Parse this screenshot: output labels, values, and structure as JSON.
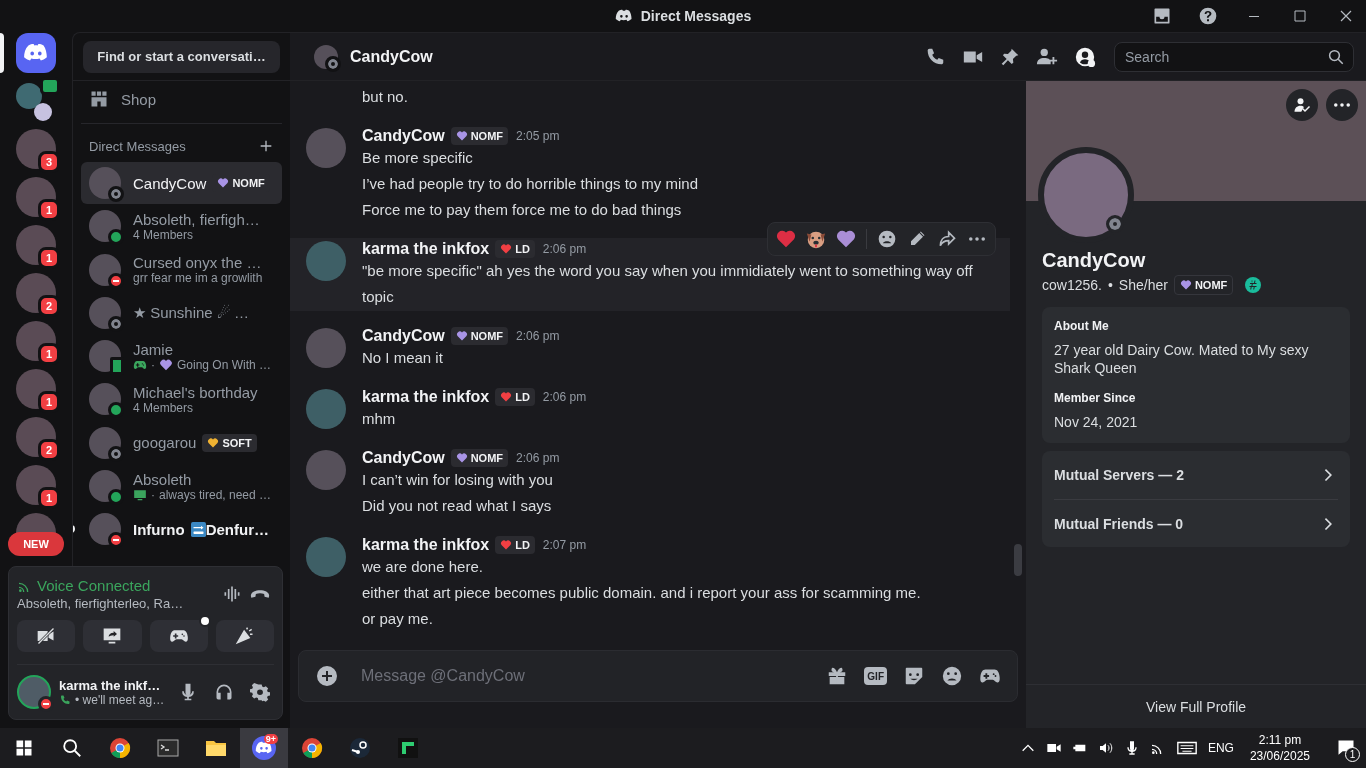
{
  "window": {
    "title": "Direct Messages"
  },
  "servers": [
    {
      "kind": "home",
      "selected": true
    },
    {
      "kind": "group",
      "selected": false
    },
    {
      "kind": "avatar",
      "badge": "3",
      "selected": false
    },
    {
      "kind": "avatar",
      "badge": "1",
      "selected": false
    },
    {
      "kind": "avatar",
      "badge": "1",
      "selected": false
    },
    {
      "kind": "avatar",
      "badge": "2",
      "selected": false
    },
    {
      "kind": "avatar",
      "badge": "1",
      "selected": false
    },
    {
      "kind": "avatar",
      "badge": "1",
      "selected": false
    },
    {
      "kind": "avatar",
      "badge": "2",
      "selected": false
    },
    {
      "kind": "avatar",
      "badge": "1",
      "selected": false
    },
    {
      "kind": "avatar",
      "selected": false
    }
  ],
  "new_pill": "NEW",
  "dm_sidebar": {
    "search": "Find or start a conversati…",
    "shop": "Shop",
    "header": "Direct Messages"
  },
  "dms": [
    {
      "name": "CandyCow",
      "tag": {
        "label": "NOMF",
        "color": "#a994e6"
      },
      "presence": {
        "kind": "offline"
      },
      "selected": true,
      "unread": false
    },
    {
      "name": "Absoleth, fierfigh…",
      "subtitle": [
        {
          "kind": "text",
          "text": "4 Members"
        }
      ],
      "presence": {
        "kind": "online"
      },
      "selected": false,
      "unread": false
    },
    {
      "name": "Cursed onyx the …",
      "subtitle": [
        {
          "kind": "text",
          "text": "grr fear me im a growlith"
        }
      ],
      "presence": {
        "kind": "dnd"
      },
      "selected": false,
      "unread": false
    },
    {
      "name": "★ Sunshine ☄ …",
      "presence": {
        "kind": "offline"
      },
      "selected": false,
      "unread": false
    },
    {
      "name": "Jamie",
      "subtitle": [
        {
          "kind": "game"
        },
        {
          "kind": "text",
          "text": "·"
        },
        {
          "kind": "heart"
        },
        {
          "kind": "text",
          "text": "Going On With …"
        }
      ],
      "presence": {
        "kind": "mobile"
      },
      "selected": false,
      "unread": false
    },
    {
      "name": "Michael's borthday",
      "subtitle": [
        {
          "kind": "text",
          "text": "4 Members"
        }
      ],
      "presence": {
        "kind": "online"
      },
      "selected": false,
      "unread": false
    },
    {
      "name": "googarou",
      "tag": {
        "label": "SOFT",
        "color": "#f0b232"
      },
      "presence": {
        "kind": "offline"
      },
      "selected": false,
      "unread": false
    },
    {
      "name": "Absoleth",
      "subtitle": [
        {
          "kind": "screen"
        },
        {
          "kind": "text",
          "text": "·"
        },
        {
          "kind": "text",
          "text": "always tired, need …"
        }
      ],
      "presence": {
        "kind": "online"
      },
      "selected": false,
      "unread": false
    },
    {
      "name": "Infurno",
      "name_after": "Denfur…",
      "presence": {
        "kind": "dnd"
      },
      "selected": false,
      "unread": true
    }
  ],
  "voice": {
    "status": "Voice Connected",
    "channel": "Absoleth, fierfighterleo, Ra…",
    "activity_dot": true
  },
  "user": {
    "name": "karma the inkf…",
    "status_text": "• we'll meet ag…",
    "presence": {
      "kind": "dnd"
    }
  },
  "chat": {
    "name": "CandyCow",
    "presence": {
      "kind": "offline"
    },
    "search_placeholder": "Search",
    "composer_placeholder": "Message @CandyCow",
    "gif_label": "GIF"
  },
  "messages": [
    {
      "continued": true,
      "lines": [
        "but no."
      ],
      "hovered": false
    },
    {
      "author": "CandyCow",
      "tag": {
        "label": "NOMF",
        "color": "#a994e6"
      },
      "time": "2:05 pm",
      "lines": [
        "Be more specific",
        "I’ve had people try to do horrible things to my mind",
        "Force me to pay them force me to do bad things"
      ],
      "hovered": false
    },
    {
      "author": "karma the inkfox",
      "tag": {
        "label": "LD",
        "color": "#f23f43"
      },
      "time": "2:06 pm",
      "lines": [
        "\"be more specific\" ah yes the word you say when you immidiately went to something way off topic"
      ],
      "hovered": true
    },
    {
      "author": "CandyCow",
      "tag": {
        "label": "NOMF",
        "color": "#a994e6"
      },
      "time": "2:06 pm",
      "lines": [
        "No I mean it"
      ],
      "hovered": false
    },
    {
      "author": "karma the inkfox",
      "tag": {
        "label": "LD",
        "color": "#f23f43"
      },
      "time": "2:06 pm",
      "lines": [
        "mhm"
      ],
      "hovered": false
    },
    {
      "author": "CandyCow",
      "tag": {
        "label": "NOMF",
        "color": "#a994e6"
      },
      "time": "2:06 pm",
      "lines": [
        "I can’t win for losing with you",
        "Did you not read what I says"
      ],
      "hovered": false
    },
    {
      "author": "karma the inkfox",
      "tag": {
        "label": "LD",
        "color": "#f23f43"
      },
      "time": "2:07 pm",
      "lines": [
        "we are done here.",
        "either that art piece becomes public domain. and i report your ass for scamming me.",
        "or pay me."
      ],
      "hovered": false
    }
  ],
  "profile": {
    "name": "CandyCow",
    "username": "cow1256.",
    "separator": "•",
    "pronouns": "She/her",
    "tag": {
      "label": "NOMF",
      "color": "#a994e6"
    },
    "presence": {
      "kind": "offline"
    },
    "about_title": "About Me",
    "about": "27 year old Dairy Cow. Mated to My sexy Shark Queen",
    "since_title": "Member Since",
    "since": "Nov 24, 2021",
    "mutuals": [
      "Mutual Servers — 2",
      "Mutual Friends — 0"
    ],
    "view_full": "View Full Profile"
  },
  "taskbar": {
    "apps": [
      {
        "kind": "chrome",
        "active": false
      },
      {
        "kind": "terminal",
        "active": false
      },
      {
        "kind": "folder",
        "active": false
      },
      {
        "kind": "discord",
        "active": true,
        "badge": "9+"
      },
      {
        "kind": "chrome",
        "active": false
      },
      {
        "kind": "steam",
        "active": false
      },
      {
        "kind": "tile",
        "active": false
      }
    ],
    "language": "ENG",
    "time": "2:11 pm",
    "date": "23/06/2025",
    "notifications": "1"
  }
}
